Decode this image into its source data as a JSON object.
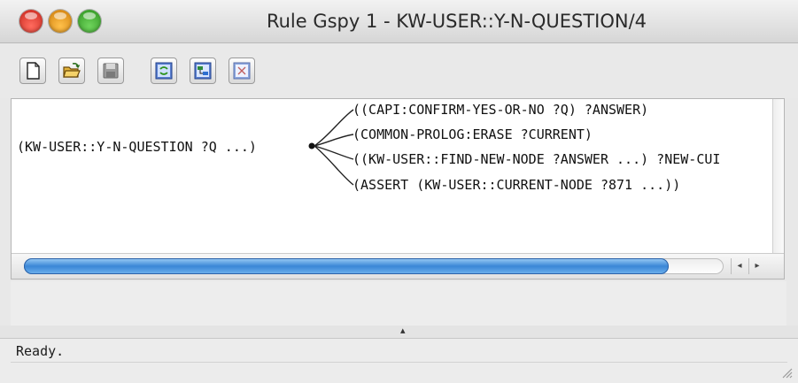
{
  "window": {
    "title": "Rule Gspy 1 - KW-USER::Y-N-QUESTION/4"
  },
  "toolbar": {
    "buttons": [
      {
        "icon": "new-document-icon"
      },
      {
        "icon": "open-folder-icon"
      },
      {
        "icon": "save-disk-icon"
      },
      {
        "icon": "refresh-graph-icon"
      },
      {
        "icon": "layout-graph-icon"
      },
      {
        "icon": "expand-graph-icon"
      }
    ]
  },
  "graph": {
    "root": "(KW-USER::Y-N-QUESTION ?Q ...)",
    "children": [
      "((CAPI:CONFIRM-YES-OR-NO ?Q) ?ANSWER)",
      "(COMMON-PROLOG:ERASE ?CURRENT)",
      "((KW-USER::FIND-NEW-NODE ?ANSWER ...) ?NEW-CUI",
      "(ASSERT (KW-USER::CURRENT-NODE ?871 ...))"
    ]
  },
  "scroll": {
    "left_arrow": "◂",
    "right_arrow": "▸"
  },
  "splitter": {
    "arrow": "▴"
  },
  "status": {
    "text": "Ready."
  },
  "colors": {
    "thumb": "#3a86d6",
    "close": "#c8261c",
    "minimize": "#cf7d0a",
    "maximize": "#2e9420"
  }
}
